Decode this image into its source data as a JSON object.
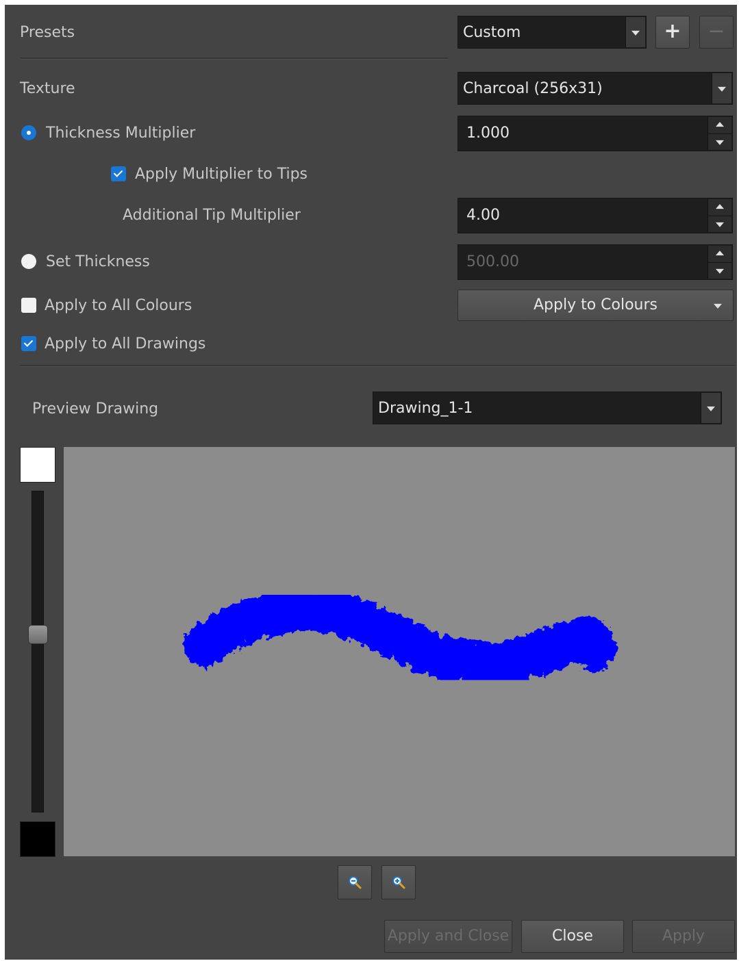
{
  "presets": {
    "label": "Presets",
    "value": "Custom",
    "add_symbol": "+",
    "remove_symbol": "−"
  },
  "texture": {
    "label": "Texture",
    "value": "Charcoal (256x31)"
  },
  "thickness_multiplier": {
    "label": "Thickness Multiplier",
    "selected": true,
    "value": "1.000"
  },
  "apply_multiplier_tips": {
    "label": "Apply Multiplier to Tips",
    "checked": true
  },
  "additional_tip": {
    "label": "Additional Tip Multiplier",
    "value": "4.00"
  },
  "set_thickness": {
    "label": "Set Thickness",
    "selected": false,
    "value": "500.00"
  },
  "apply_all_colours": {
    "label": "Apply to All Colours",
    "checked": false,
    "button": "Apply to Colours"
  },
  "apply_all_drawings": {
    "label": "Apply to All Drawings",
    "checked": true
  },
  "preview": {
    "label": "Preview Drawing",
    "value": "Drawing_1-1",
    "background_level": 0.37,
    "stroke_color": "#0000ff",
    "canvas_color": "#8c8c8c"
  },
  "footer": {
    "apply_close": "Apply and Close",
    "close": "Close",
    "apply": "Apply"
  },
  "colors": {
    "panel": "#444444",
    "field": "#1e1e1e",
    "accent": "#1976d2"
  }
}
